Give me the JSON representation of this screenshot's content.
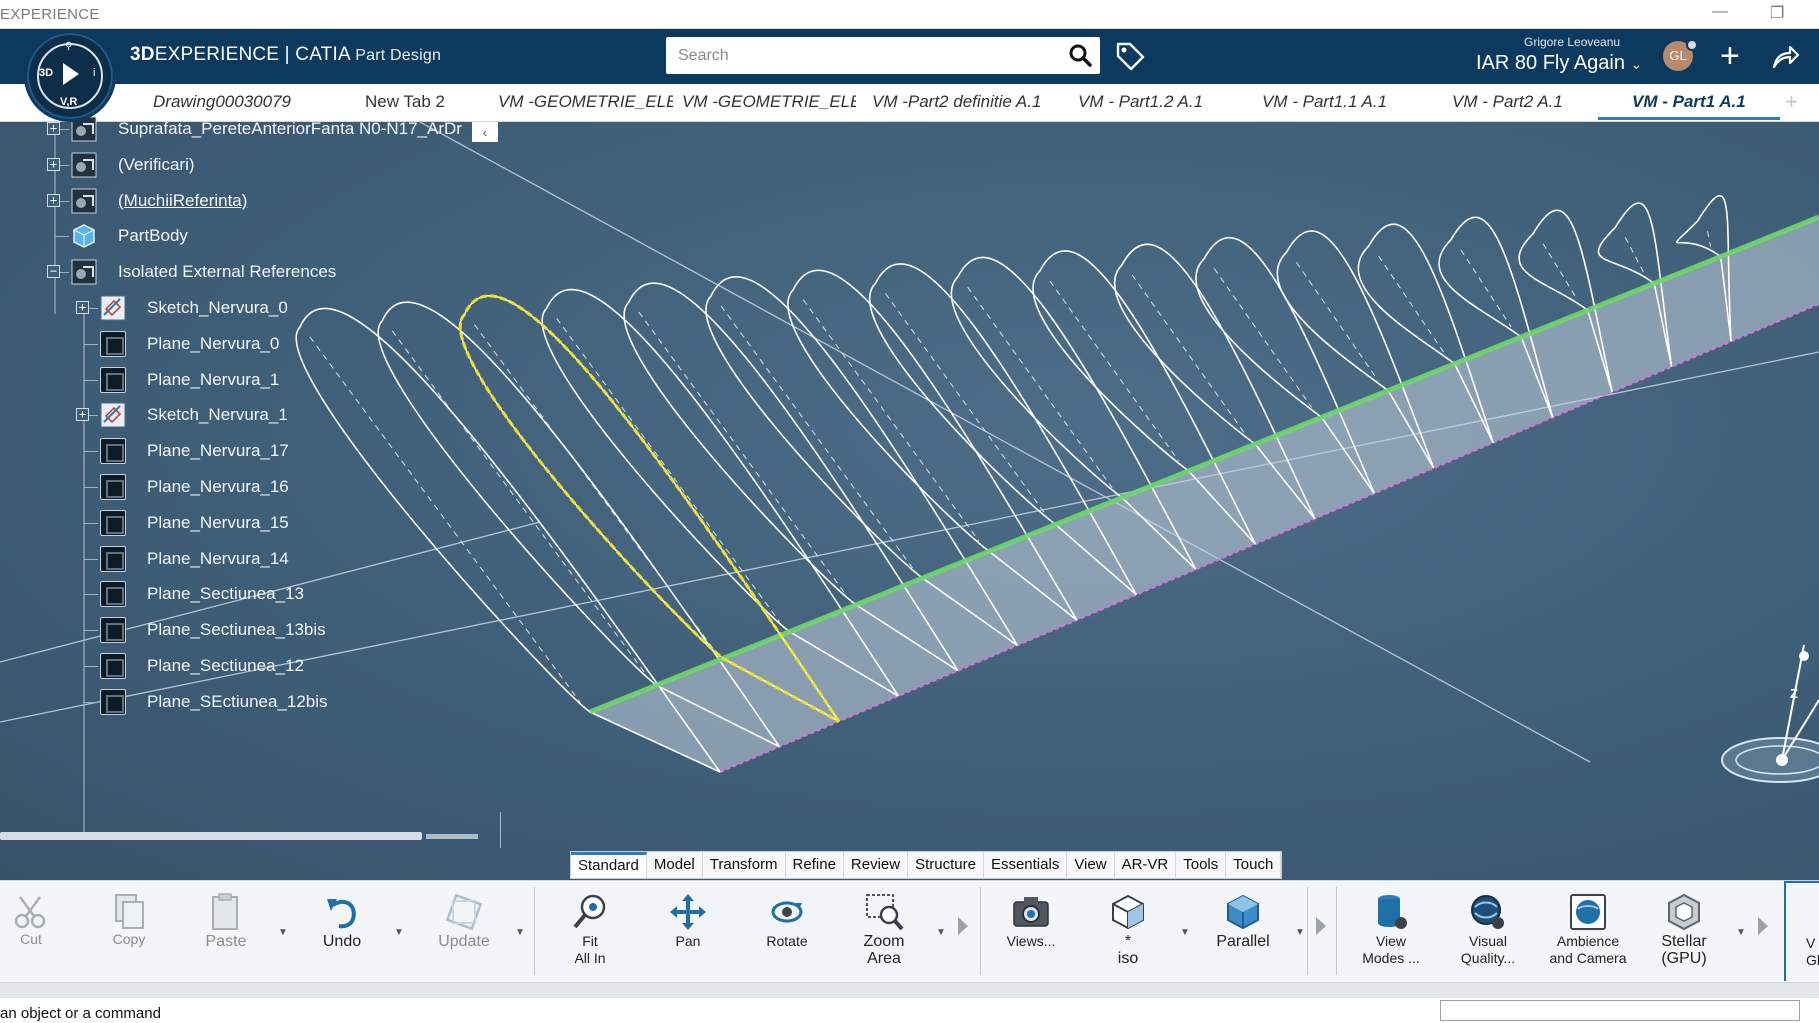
{
  "window": {
    "title": "EXPERIENCE"
  },
  "header": {
    "brand_bold": "3D",
    "brand_rest": "EXPERIENCE | CATIA",
    "app": "Part Design",
    "compass_3d": "3D",
    "compass_vr": "V,R",
    "compass_i": "i",
    "search_placeholder": "Search",
    "user_name": "Grigore Leoveanu",
    "collab_space": "IAR 80 Fly Again",
    "avatar_initials": "GL"
  },
  "tabs": [
    {
      "label": "Drawing00030079",
      "italic": true
    },
    {
      "label": "New Tab 2",
      "italic": false
    },
    {
      "label": "VM -GEOMETRIE_ELERO",
      "italic": true
    },
    {
      "label": "VM -GEOMETRIE_ELERO",
      "italic": true
    },
    {
      "label": "VM -Part2 definitie A.1",
      "italic": true
    },
    {
      "label": "VM - Part1.2 A.1",
      "italic": true
    },
    {
      "label": "VM - Part1.1 A.1",
      "italic": true
    },
    {
      "label": "VM - Part2 A.1",
      "italic": true
    },
    {
      "label": "VM - Part1 A.1",
      "italic": true,
      "active": true
    }
  ],
  "tree": {
    "collapse_glyph": "‹",
    "items": [
      {
        "label": "Suprafata_PereteAnteriorFanta N0-N17_ArDr",
        "level": 0,
        "expander": "+"
      },
      {
        "label": "(Verificari)",
        "level": 0,
        "expander": "+"
      },
      {
        "label": "(MuchiiReferinta)",
        "level": 0,
        "expander": "+"
      },
      {
        "label": "PartBody",
        "level": 0,
        "expander": ""
      },
      {
        "label": "Isolated External References",
        "level": 0,
        "expander": "−"
      },
      {
        "label": "Sketch_Nervura_0",
        "level": 1,
        "expander": "+"
      },
      {
        "label": "Plane_Nervura_0",
        "level": 1,
        "expander": ""
      },
      {
        "label": "Plane_Nervura_1",
        "level": 1,
        "expander": ""
      },
      {
        "label": "Sketch_Nervura_1",
        "level": 1,
        "expander": "+"
      },
      {
        "label": "Plane_Nervura_17",
        "level": 1,
        "expander": ""
      },
      {
        "label": "Plane_Nervura_16",
        "level": 1,
        "expander": ""
      },
      {
        "label": "Plane_Nervura_15",
        "level": 1,
        "expander": ""
      },
      {
        "label": "Plane_Nervura_14",
        "level": 1,
        "expander": ""
      },
      {
        "label": "Plane_Sectiunea_13",
        "level": 1,
        "expander": ""
      },
      {
        "label": "Plane_Sectiunea_13bis",
        "level": 1,
        "expander": ""
      },
      {
        "label": "Plane_Sectiunea_12",
        "level": 1,
        "expander": ""
      },
      {
        "label": "Plane_SEctiunea_12bis",
        "level": 1,
        "expander": ""
      }
    ]
  },
  "axis": {
    "z_label": "Z"
  },
  "sections": [
    "Standard",
    "Model",
    "Transform",
    "Refine",
    "Review",
    "Structure",
    "Essentials",
    "View",
    "AR-VR",
    "Tools",
    "Touch"
  ],
  "active_section": "Standard",
  "toolbar": {
    "cut": "Cut",
    "copy": "Copy",
    "paste": "Paste",
    "undo": "Undo",
    "update": "Update",
    "fit_all_in_1": "Fit",
    "fit_all_in_2": "All In",
    "pan": "Pan",
    "rotate": "Rotate",
    "zoom_area_1": "Zoom",
    "zoom_area_2": "Area",
    "views": "Views...",
    "iso_1": "*",
    "iso_2": "iso",
    "parallel": "Parallel",
    "view_modes_1": "View",
    "view_modes_2": "Modes ...",
    "visual_quality_1": "Visual",
    "visual_quality_2": "Quality...",
    "ambience_1": "Ambience",
    "ambience_2": "and Camera",
    "stellar_1": "Stellar",
    "stellar_2": "(GPU)",
    "cut_off_1": "V",
    "cut_off_2": "Gl"
  },
  "status": {
    "text": "an object or a command"
  },
  "colors": {
    "header_bg": "#0b3a5e",
    "viewport_bg": "#3f5e78",
    "highlight_profile": "#f2e21a",
    "spar_green": "#6fd86a",
    "trailing_edge": "#e36ee0",
    "accent": "#2f7ab8"
  }
}
